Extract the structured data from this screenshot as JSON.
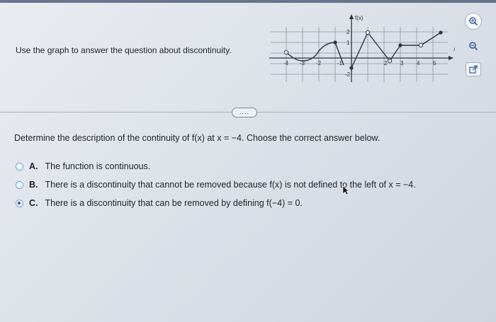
{
  "instruction": "Use the graph to answer the question about discontinuity.",
  "graph": {
    "func_label": "f(x)",
    "x_label": "x",
    "x_ticks": [
      "-4",
      "-3",
      "-2",
      "-1",
      "2",
      "3",
      "4",
      "5"
    ],
    "y_ticks": [
      "2",
      "1",
      "-2"
    ]
  },
  "tools": [
    "zoom-in-icon",
    "zoom-out-icon",
    "external-link-icon"
  ],
  "more_button": "....",
  "question": "Determine the description of the continuity of f(x) at x = −4. Choose the correct answer below.",
  "options": [
    {
      "letter": "A.",
      "text": "The function is continuous.",
      "selected": false
    },
    {
      "letter": "B.",
      "text": "There is a discontinuity that cannot be removed because f(x) is not defined to the left of x = −4.",
      "selected": false
    },
    {
      "letter": "C.",
      "text": "There is a discontinuity that can be removed by defining f(−4) = 0.",
      "selected": true
    }
  ]
}
